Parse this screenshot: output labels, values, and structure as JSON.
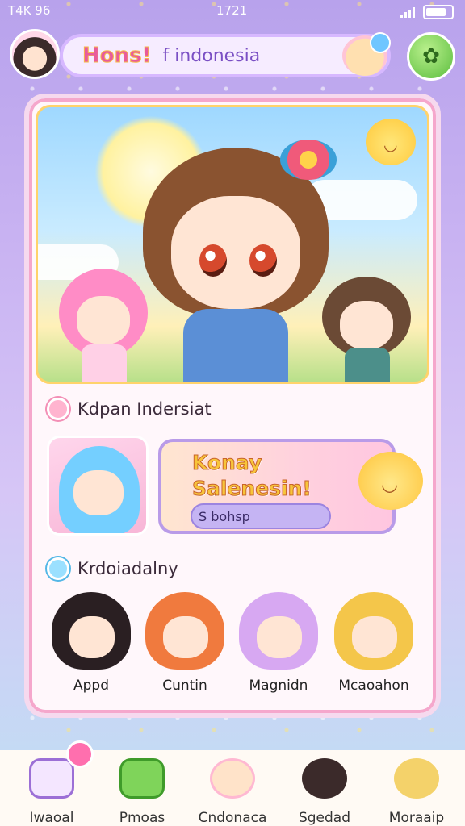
{
  "status_bar": {
    "left": "T4K 96",
    "time": "1721"
  },
  "header": {
    "title_bold": "Hons!",
    "title_sub": "f indonesia"
  },
  "section_one": {
    "title": "Kdpan Indersiat"
  },
  "promo": {
    "line1": "Konay",
    "line2": "Salenesin!",
    "pill": "S bohsp"
  },
  "section_two": {
    "title": "Krdoiadalny"
  },
  "characters": [
    {
      "name": "Appd",
      "hair": "#2a1f22"
    },
    {
      "name": "Cuntin",
      "hair": "#f07a3e"
    },
    {
      "name": "Magnidn",
      "hair": "#d7a8f2"
    },
    {
      "name": "Mcaoahon",
      "hair": "#f4c64a"
    }
  ],
  "nav": [
    {
      "label": "Iwaoal",
      "icon": "home-icon"
    },
    {
      "label": "Pmoas",
      "icon": "shop-icon"
    },
    {
      "label": "Cndonaca",
      "icon": "mascot-chat-icon"
    },
    {
      "label": "Sgedad",
      "icon": "character-icon"
    },
    {
      "label": "Moraaip",
      "icon": "profile-icon"
    }
  ],
  "colors": {
    "accent_pink": "#f38fb6",
    "accent_purple": "#b99be8",
    "brand_green": "#5bbd3e"
  }
}
